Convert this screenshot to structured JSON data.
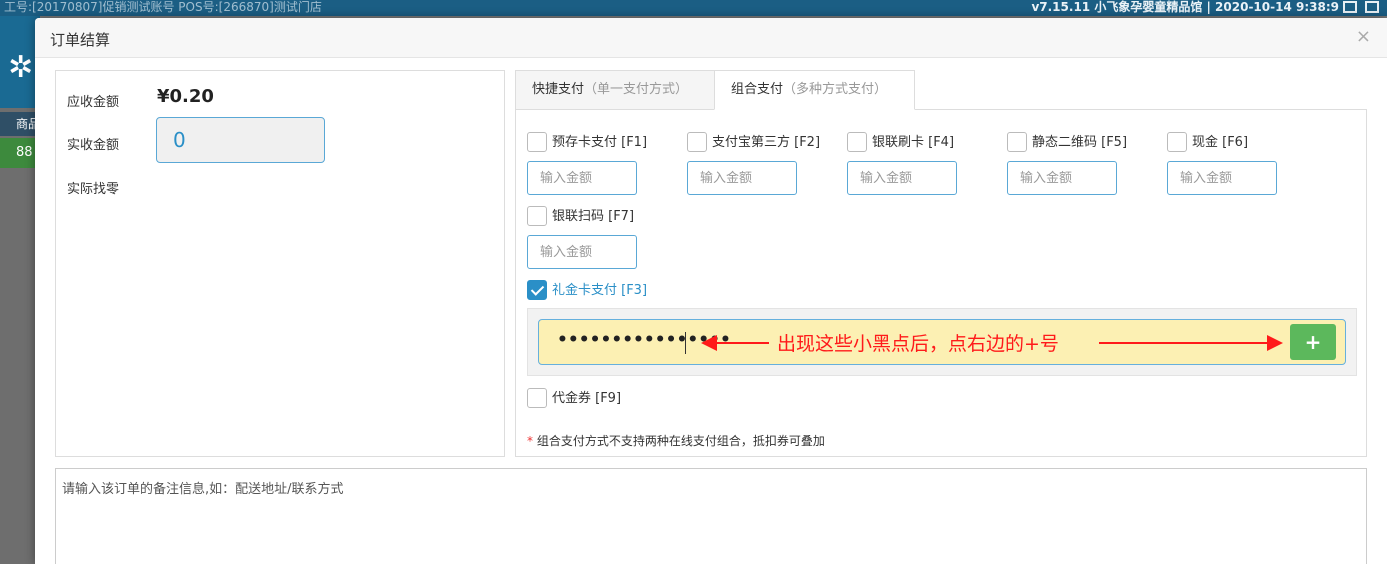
{
  "background": {
    "topbar_left": "工号:[20170807]促销测试账号   POS号:[266870]测试门店",
    "topbar_right": "v7.15.11 小飞象孕婴童精品馆 | 2020-10-14 9:38:9",
    "side_tab1": "商品",
    "side_tab2": "88"
  },
  "modal": {
    "title": "订单结算",
    "close": "×"
  },
  "summary": {
    "due_label": "应收金额",
    "due_value": "¥0.20",
    "received_label": "实收金额",
    "received_value": "0",
    "change_label": "实际找零"
  },
  "tabs": [
    {
      "label": "快捷支付",
      "sub": "（单一支付方式）"
    },
    {
      "label": "组合支付",
      "sub": "（多种方式支付）"
    }
  ],
  "payment_methods": [
    {
      "label": "预存卡支付 [F1]",
      "placeholder": "输入金额"
    },
    {
      "label": "支付宝第三方 [F2]",
      "placeholder": "输入金额"
    },
    {
      "label": "银联刷卡 [F4]",
      "placeholder": "输入金额"
    },
    {
      "label": "静态二维码 [F5]",
      "placeholder": "输入金额"
    },
    {
      "label": "现金 [F6]",
      "placeholder": "输入金额"
    },
    {
      "label": "银联扫码 [F7]",
      "placeholder": "输入金额"
    }
  ],
  "gift_card": {
    "label": "礼金卡支付 [F3]",
    "masked_value": "••••••••••••••••",
    "annotation": "出现这些小黑点后，点右边的+号",
    "add_label": "+"
  },
  "voucher_label": "代金券 [F9]",
  "note": {
    "star": "*",
    "text": " 组合支付方式不支持两种在线支付组合，抵扣券可叠加"
  },
  "remark_placeholder": "请输入该订单的备注信息,如：配送地址/联系方式"
}
